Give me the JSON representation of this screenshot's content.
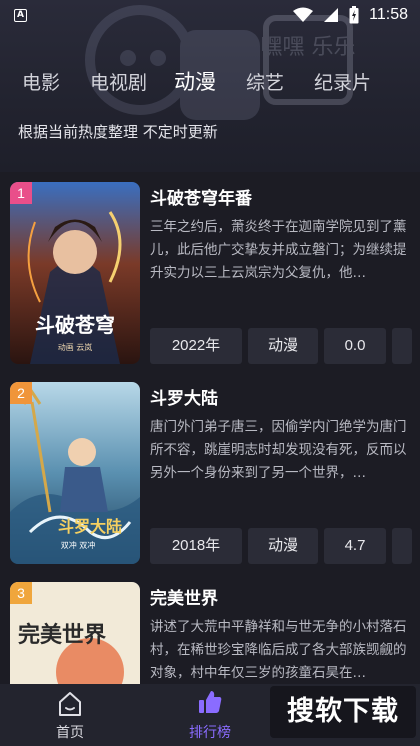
{
  "status_bar": {
    "time": "11:58",
    "app_badge": "A"
  },
  "header": {
    "tabs": [
      {
        "label": "电影"
      },
      {
        "label": "电视剧"
      },
      {
        "label": "动漫"
      },
      {
        "label": "综艺"
      },
      {
        "label": "纪录片"
      }
    ],
    "active_tab": "动漫",
    "subtitle": "根据当前热度整理 不定时更新",
    "decor_text": "嘿嘿 乐乐"
  },
  "items": [
    {
      "rank": "1",
      "title": "斗破苍穹年番",
      "desc": "三年之约后，萧炎终于在迦南学院见到了薰儿，此后他广交挚友并成立磐门；为继续提升实力以三上云岚宗为父复仇，他…",
      "year": "2022年",
      "genre": "动漫",
      "score": "0.0",
      "poster_caption": "斗破苍穹",
      "poster_sub": "动画 云岚",
      "rank_color": "#e94f8a"
    },
    {
      "rank": "2",
      "title": "斗罗大陆",
      "desc": "唐门外门弟子唐三，因偷学内门绝学为唐门所不容，跳崖明志时却发现没有死，反而以另外一个身份来到了另一个世界，…",
      "year": "2018年",
      "genre": "动漫",
      "score": "4.7",
      "poster_caption": "斗罗大陆",
      "poster_sub": "双冲 双冲",
      "rank_color": "#f0953a"
    },
    {
      "rank": "3",
      "title": "完美世界",
      "desc": "讲述了大荒中平静祥和与世无争的小村落石村，在稀世珍宝降临后成了各大部族觊觎的对象，村中年仅三岁的孩童石昊在…",
      "year": "",
      "genre": "",
      "score": "",
      "poster_caption": "完美世界",
      "poster_sub": "",
      "rank_color": "#f0a63c"
    }
  ],
  "bottom_nav": {
    "items": [
      {
        "label": "首页",
        "icon": "home-icon"
      },
      {
        "label": "排行榜",
        "icon": "thumbs-up-icon"
      }
    ],
    "active": "排行榜"
  },
  "watermark": "搜软下载",
  "colors": {
    "accent": "#8a6cff",
    "bg": "#1c1c24",
    "chip": "#2b2c37"
  }
}
